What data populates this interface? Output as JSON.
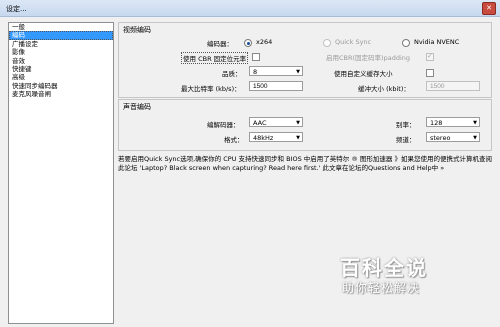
{
  "window": {
    "title": "设定...",
    "close_glyph": "✕"
  },
  "sidebar": {
    "items": [
      {
        "label": "一般",
        "selected": false
      },
      {
        "label": "编码",
        "selected": true
      },
      {
        "label": "广播设定",
        "selected": false
      },
      {
        "label": "影像",
        "selected": false
      },
      {
        "label": "音效",
        "selected": false
      },
      {
        "label": "快捷键",
        "selected": false
      },
      {
        "label": "高级",
        "selected": false
      },
      {
        "label": "快速同步编码器",
        "selected": false
      },
      {
        "label": "麦克风噪音闸",
        "selected": false
      }
    ]
  },
  "video": {
    "section_title": "视频编码",
    "encoder_label": "编码器：",
    "encoder_options": [
      {
        "label": "x264",
        "selected": true,
        "disabled": false
      },
      {
        "label": "Quick Sync",
        "selected": false,
        "disabled": true
      },
      {
        "label": "Nvidia NVENC",
        "selected": false,
        "disabled": false
      }
    ],
    "cbr_label": "使用 CBR 固定位元率",
    "cbr_padding_label": "启用CBR(固定码率)padding",
    "quality_label": "品质：",
    "quality_value": "8",
    "custom_buffer_label": "使用自定义缓存大小",
    "max_bitrate_label": "最大比特率 (kb/s)：",
    "max_bitrate_value": "1500",
    "buffer_label": "缓冲大小 (kbit)：",
    "buffer_value": "1500"
  },
  "audio": {
    "section_title": "声音编码",
    "codec_label": "编解码器：",
    "codec_value": "AAC",
    "bitrate_label": "别率：",
    "bitrate_value": "128",
    "format_label": "格式：",
    "format_value": "48kHz",
    "channel_label": "频道：",
    "channel_value": "stereo"
  },
  "note": "若要启用Quick Sync选项,确保你的 CPU 支持快速同步和 BIOS 中启用了英特尔 ® 图形加速器 》如果您使用的便携式计算机查阅此论坛 'Laptop? Black screen when capturing? Read here first.' 此文章在论坛的Questions and Help中 »",
  "watermark": {
    "main": "百科全说",
    "sub": "助你轻松解决"
  },
  "icons": {
    "dropdown": "▼"
  }
}
